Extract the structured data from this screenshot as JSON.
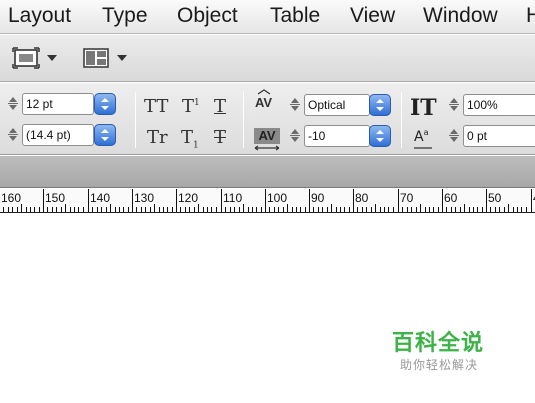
{
  "menubar": {
    "items": [
      "Layout",
      "Type",
      "Object",
      "Table",
      "View",
      "Window",
      "H"
    ]
  },
  "toolbar": {
    "screen_mode_icon": "screen-mode-icon",
    "arrange_docs_icon": "arrange-documents-icon"
  },
  "control_panel": {
    "font_size": "12 pt",
    "leading": "(14.4 pt)",
    "kerning": "Optical",
    "tracking": "-10",
    "vertical_scale": "100%",
    "baseline_shift": "0 pt",
    "type_buttons": {
      "all_caps": "TT",
      "superscript": "T",
      "underline": "T",
      "small_caps": "Tr",
      "subscript": "T",
      "strikethrough": "T"
    },
    "kerning_icon_label": "AV",
    "tracking_icon_label": "AV",
    "vscale_icon_label": "IT",
    "baseline_icon_label": "A"
  },
  "ruler": {
    "labels": [
      "160",
      "150",
      "140",
      "130",
      "120",
      "110",
      "100",
      "90",
      "80",
      "70",
      "60",
      "50",
      "4"
    ]
  },
  "watermark": {
    "title": "百科全说",
    "subtitle": "助你轻松解决"
  },
  "colors": {
    "accent_blue": "#2f6fd6",
    "watermark_green": "#3cb346"
  }
}
